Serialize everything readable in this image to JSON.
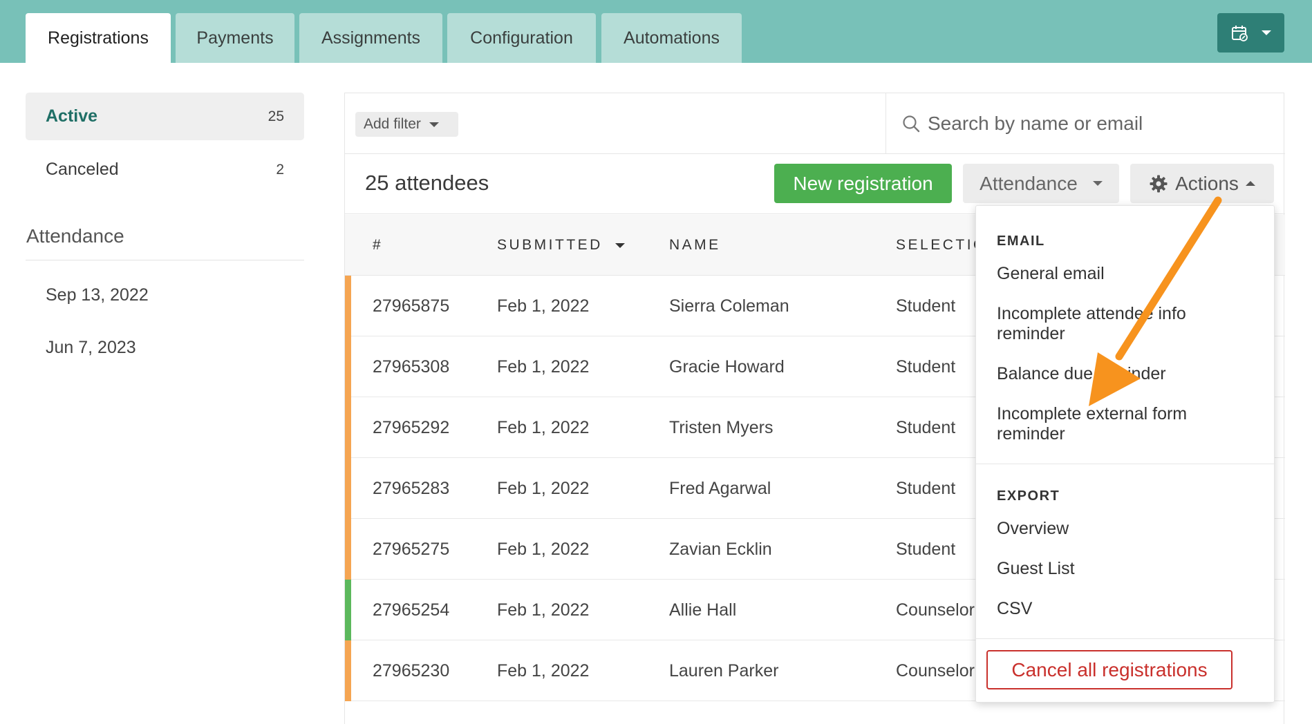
{
  "tabs": [
    {
      "label": "Registrations",
      "active": true
    },
    {
      "label": "Payments"
    },
    {
      "label": "Assignments"
    },
    {
      "label": "Configuration"
    },
    {
      "label": "Automations"
    }
  ],
  "calendar_button": {
    "icon": "calendar-link-icon"
  },
  "sidebar": {
    "statuses": [
      {
        "label": "Active",
        "count": "25",
        "active": true
      },
      {
        "label": "Canceled",
        "count": "2"
      }
    ],
    "attendance_heading": "Attendance",
    "dates": [
      "Sep 13, 2022",
      "Jun 7, 2023"
    ]
  },
  "filter": {
    "add_filter_label": "Add filter"
  },
  "search": {
    "placeholder": "Search by name or email"
  },
  "toolbar": {
    "attendee_count": "25 attendees",
    "new_registration": "New registration",
    "attendance": "Attendance",
    "actions": "Actions"
  },
  "table": {
    "columns": [
      "#",
      "SUBMITTED",
      "NAME",
      "SELECTION"
    ],
    "rows": [
      {
        "id": "27965875",
        "submitted": "Feb 1, 2022",
        "name": "Sierra Coleman",
        "selection": "Student",
        "status_color": "#f5a552"
      },
      {
        "id": "27965308",
        "submitted": "Feb 1, 2022",
        "name": "Gracie Howard",
        "selection": "Student",
        "status_color": "#f5a552"
      },
      {
        "id": "27965292",
        "submitted": "Feb 1, 2022",
        "name": "Tristen Myers",
        "selection": "Student",
        "status_color": "#f5a552"
      },
      {
        "id": "27965283",
        "submitted": "Feb 1, 2022",
        "name": "Fred Agarwal",
        "selection": "Student",
        "status_color": "#f5a552"
      },
      {
        "id": "27965275",
        "submitted": "Feb 1, 2022",
        "name": "Zavian Ecklin",
        "selection": "Student",
        "status_color": "#f5a552"
      },
      {
        "id": "27965254",
        "submitted": "Feb 1, 2022",
        "name": "Allie Hall",
        "selection": "Counselor",
        "status_color": "#5cb85c"
      },
      {
        "id": "27965230",
        "submitted": "Feb 1, 2022",
        "name": "Lauren Parker",
        "selection": "Counselor",
        "status_color": "#f5a552"
      }
    ]
  },
  "actions_menu": {
    "email_heading": "EMAIL",
    "email_items": [
      "General email",
      "Incomplete attendee info reminder",
      "Balance due reminder",
      "Incomplete external form reminder"
    ],
    "export_heading": "EXPORT",
    "export_items": [
      "Overview",
      "Guest List",
      "CSV"
    ],
    "cancel_all": "Cancel all registrations"
  },
  "colors": {
    "header_bg": "#78c1b8",
    "accent_green": "#4caf50",
    "danger": "#c9302c",
    "annotation_arrow": "#f7931e"
  }
}
